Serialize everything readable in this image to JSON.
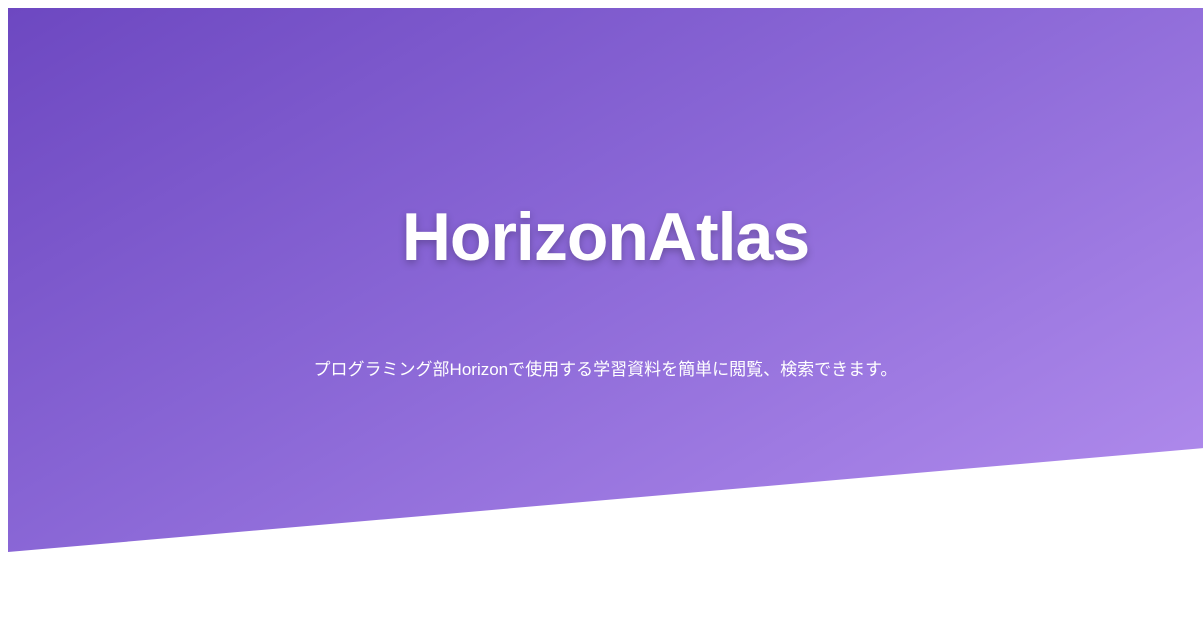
{
  "hero": {
    "title": "HorizonAtlas",
    "subtitle": "プログラミング部Horizonで使用する学習資料を簡単に閲覧、検索できます。",
    "gradient_start": "#6d48c1",
    "gradient_end": "#b38eee"
  }
}
